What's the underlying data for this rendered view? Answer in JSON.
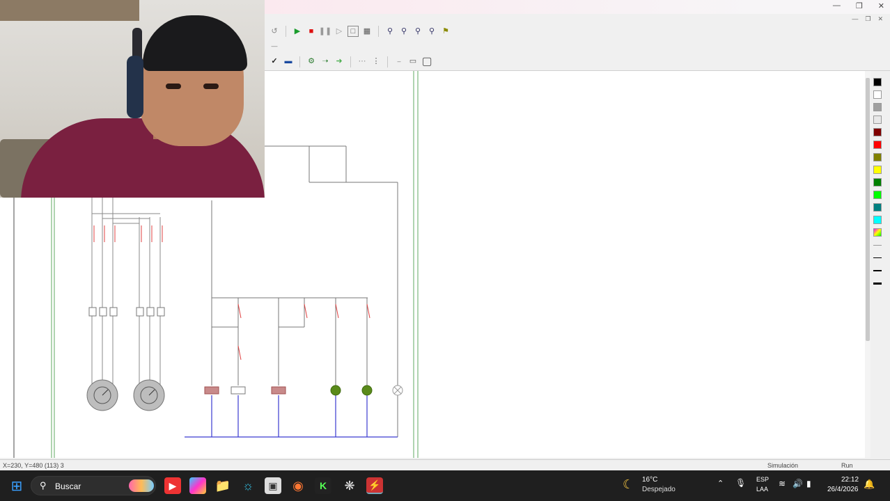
{
  "status": {
    "coords": "X=230, Y=480 (113) 3",
    "mode": "Simulación",
    "state": "Run"
  },
  "taskbar": {
    "search_label": "Buscar",
    "weather_temp": "16°C",
    "weather_desc": "Despejado",
    "lang_top": "ESP",
    "lang_bottom": "LAA",
    "time": "22:12",
    "date": "26/4/2026"
  },
  "palette_colors": [
    "#000000",
    "#ffffff",
    "#a0a0a0",
    "#e8e8e8",
    "#800000",
    "#ff0000",
    "#808000",
    "#ffff00",
    "#008000",
    "#00ff00",
    "#008080",
    "#00ffff"
  ],
  "accent_color": "#0078d4"
}
